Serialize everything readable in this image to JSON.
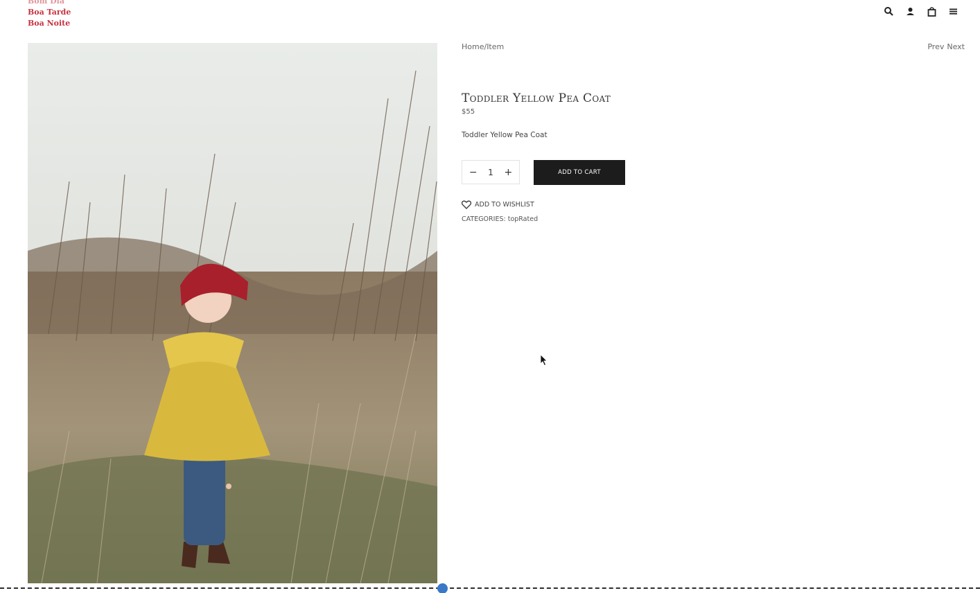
{
  "header": {
    "logo_lines": [
      "Bom Dia",
      "Boa Tarde",
      "Boa Noite"
    ],
    "icons": [
      "search-icon",
      "user-icon",
      "bag-icon",
      "menu-icon"
    ]
  },
  "breadcrumb": {
    "text": "Home/Item"
  },
  "pager": {
    "prev": "Prev",
    "next": "Next"
  },
  "product": {
    "title": "Toddler Yellow Pea Coat",
    "price": "$55",
    "short_description": "Toddler Yellow Pea Coat",
    "quantity": "1",
    "add_to_cart_label": "ADD TO CART",
    "wishlist_label": "ADD TO WISHLIST",
    "categories_label": "CATEGORIES:",
    "category": "topRated"
  },
  "colors": {
    "logo": "#c8323e",
    "button": "#1c1c1c",
    "handle": "#3a78c8"
  }
}
